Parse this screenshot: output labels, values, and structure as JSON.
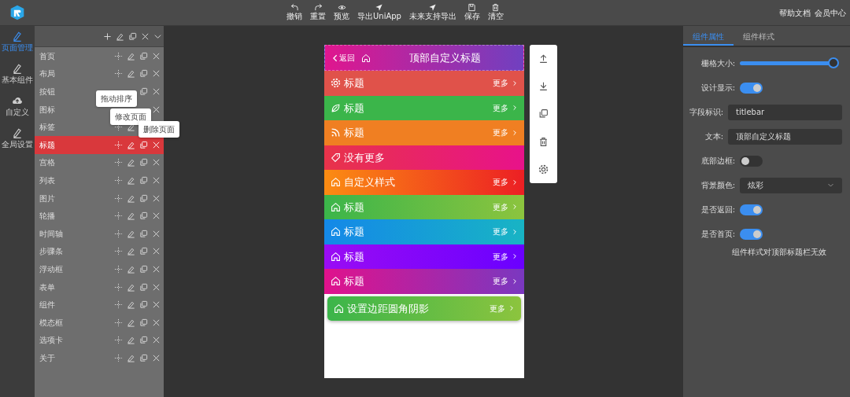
{
  "toolbar": [
    "撤销",
    "重置",
    "预览",
    "导出UniApp",
    "未来支持导出",
    "保存",
    "清空"
  ],
  "header_links": [
    "帮助文档",
    "会员中心"
  ],
  "rail": [
    {
      "label": "页面管理",
      "selected": true
    },
    {
      "label": "基本组件",
      "selected": false
    },
    {
      "label": "自定义",
      "selected": false
    },
    {
      "label": "全局设置",
      "selected": false
    }
  ],
  "pages": [
    {
      "name": "首页",
      "selected": false
    },
    {
      "name": "布局",
      "selected": false
    },
    {
      "name": "按钮",
      "selected": false
    },
    {
      "name": "图标",
      "selected": false
    },
    {
      "name": "标签",
      "selected": false
    },
    {
      "name": "标题",
      "selected": true
    },
    {
      "name": "宫格",
      "selected": false
    },
    {
      "name": "列表",
      "selected": false
    },
    {
      "name": "图片",
      "selected": false
    },
    {
      "name": "轮播",
      "selected": false
    },
    {
      "name": "时间轴",
      "selected": false
    },
    {
      "name": "步骤条",
      "selected": false
    },
    {
      "name": "浮动框",
      "selected": false
    },
    {
      "name": "表单",
      "selected": false
    },
    {
      "name": "组件",
      "selected": false
    },
    {
      "name": "模态框",
      "selected": false
    },
    {
      "name": "选项卡",
      "selected": false
    },
    {
      "name": "关于",
      "selected": false
    }
  ],
  "tooltips": [
    "拖动排序",
    "修改页面",
    "删除页面"
  ],
  "phone": {
    "back": "返回",
    "title": "顶部自定义标题",
    "color": "#e0168e",
    "rows": [
      {
        "title": "标题",
        "more": "更多",
        "color": "#e0524a",
        "card": false
      },
      {
        "title": "标题",
        "more": "更多",
        "color": "#3bb54a",
        "card": false
      },
      {
        "title": "标题",
        "more": "更多",
        "color": "#f07f22",
        "card": false
      },
      {
        "title": "没有更多",
        "color": "#e8334a",
        "card": false
      },
      {
        "title": "自定义样式",
        "more": "更多",
        "color": "#fb8c12",
        "card": false
      },
      {
        "title": "标题",
        "more": "更多",
        "color": "#3bb54a",
        "card": false
      },
      {
        "title": "标题",
        "more": "更多",
        "color": "#1488e8",
        "card": false
      },
      {
        "title": "标题",
        "more": "更多",
        "color": "#9a0cf4",
        "card": false
      },
      {
        "title": "标题",
        "more": "更多",
        "color": "#e0128c",
        "card": false
      },
      {
        "title": "设置边距圆角阴影",
        "more": "更多",
        "color": "#3bb54a",
        "card": true
      }
    ]
  },
  "props": {
    "tabs": [
      {
        "label": "组件属性",
        "selected": true
      },
      {
        "label": "组件样式",
        "selected": false
      }
    ],
    "fields": [
      {
        "kind": "slider",
        "label": "栅格大小:",
        "level": 1
      },
      {
        "kind": "toggle",
        "label": "设计显示:",
        "on": true
      },
      {
        "kind": "input",
        "label": "字段标识:",
        "value": "titlebar"
      },
      {
        "kind": "input",
        "label": "文本:",
        "value": "顶部自定义标题"
      },
      {
        "kind": "toggle",
        "label": "底部边框:",
        "on": false
      },
      {
        "kind": "select",
        "label": "背景颜色:",
        "value": "炫彩"
      },
      {
        "kind": "toggle",
        "label": "是否返回:",
        "on": true
      },
      {
        "kind": "toggle",
        "label": "是否首页:",
        "on": true
      }
    ],
    "note": "组件样式对顶部标题栏无效"
  }
}
